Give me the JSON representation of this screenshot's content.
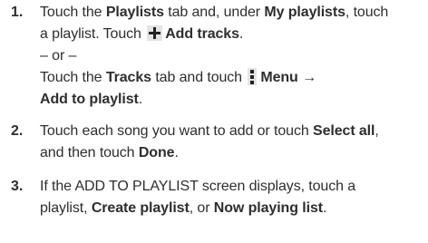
{
  "steps": [
    {
      "number": "1.",
      "line1": {
        "t1": "Touch the ",
        "b1": "Playlists",
        "t2": " tab and, under ",
        "b2": "My playlists",
        "t3": ", touch"
      },
      "line2": {
        "t1": "a playlist. Touch ",
        "icon": "plus-icon",
        "b1": "Add tracks",
        "t2": "."
      },
      "line3": {
        "t1": "– or –"
      },
      "line4": {
        "t1": "Touch the ",
        "b1": "Tracks",
        "t2": " tab and touch ",
        "icon": "menu-icon",
        "b2": "Menu →"
      },
      "line5": {
        "b1": "Add to playlist",
        "t1": "."
      }
    },
    {
      "number": "2.",
      "line1": {
        "t1": "Touch each song you want to add or touch ",
        "b1": "Select all",
        "t2": ","
      },
      "line2": {
        "t1": "and then touch ",
        "b1": "Done",
        "t2": "."
      }
    },
    {
      "number": "3.",
      "line1": {
        "t1": "If the ADD TO PLAYLIST screen displays, touch a"
      },
      "line2": {
        "t1": "playlist, ",
        "b1": "Create playlist",
        "t2": ", or ",
        "b2": "Now playing list",
        "t3": "."
      }
    }
  ]
}
